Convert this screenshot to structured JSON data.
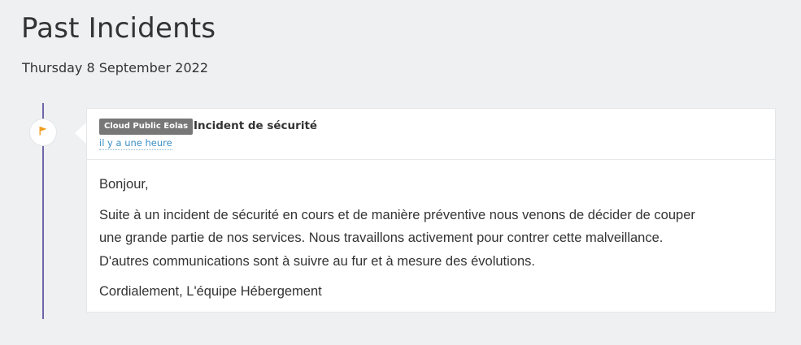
{
  "header": {
    "title": "Past Incidents",
    "date": "Thursday 8 September 2022"
  },
  "incident": {
    "status_icon": "flag-icon",
    "status_color": "#f29b1c",
    "component": "Cloud Public Eolas",
    "title": "Incident de sécurité",
    "timestamp": "il y a une heure",
    "message": {
      "greeting": "Bonjour,",
      "line_1": "Suite à un incident de sécurité en cours et de manière préventive nous venons de décider de couper",
      "line_2": "une grande partie de nos services. Nous travaillons activement pour contrer cette malveillance.",
      "line_3": "D'autres communications sont à suivre au fur et à mesure des évolutions.",
      "signature": "Cordialement, L'équipe Hébergement"
    }
  },
  "colors": {
    "background": "#eef0f2",
    "timeline": "#6b67a8",
    "badge": "#777777",
    "link": "#3b8fc5"
  }
}
